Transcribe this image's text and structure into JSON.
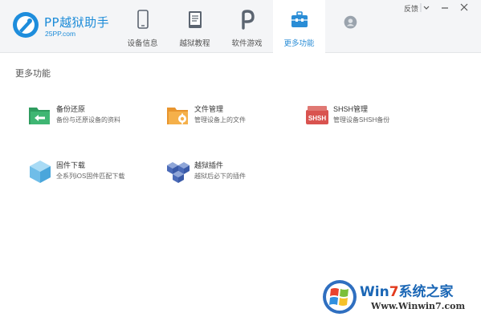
{
  "app": {
    "title": "PP越狱助手",
    "subtitle": "25PP.com"
  },
  "tabs": [
    {
      "label": "设备信息",
      "icon": "phone-icon",
      "active": false
    },
    {
      "label": "越狱教程",
      "icon": "book-icon",
      "active": false
    },
    {
      "label": "软件游戏",
      "icon": "pp-store-icon",
      "active": false
    },
    {
      "label": "更多功能",
      "icon": "toolbox-icon",
      "active": true
    }
  ],
  "window": {
    "feedback": "反馈",
    "icons": [
      "dropdown-icon",
      "minimize-icon",
      "close-icon"
    ]
  },
  "main": {
    "section_title": "更多功能",
    "features": [
      {
        "name": "备份还原",
        "desc": "备份与还原设备的资料",
        "icon": "backup-folder-icon"
      },
      {
        "name": "文件管理",
        "desc": "管理设备上的文件",
        "icon": "file-folder-icon"
      },
      {
        "name": "SHSH管理",
        "desc": "管理设备SHSH备份",
        "icon": "shsh-icon",
        "icon_text": "SHSH"
      },
      {
        "name": "固件下载",
        "desc": "全系列iOS固件匹配下载",
        "icon": "firmware-cube-icon"
      },
      {
        "name": "越狱插件",
        "desc": "越狱后必下的插件",
        "icon": "plugin-boxes-icon"
      }
    ]
  },
  "watermark": {
    "title_prefix": "Win",
    "title_hl": "7",
    "title_suffix": "系统之家",
    "url": "Www.Winwin7.com"
  },
  "colors": {
    "accent": "#2a8dd6",
    "green": "#3aa56a",
    "orange": "#f0a040",
    "red": "#d9534f",
    "blue_cube": "#6fbde8"
  }
}
